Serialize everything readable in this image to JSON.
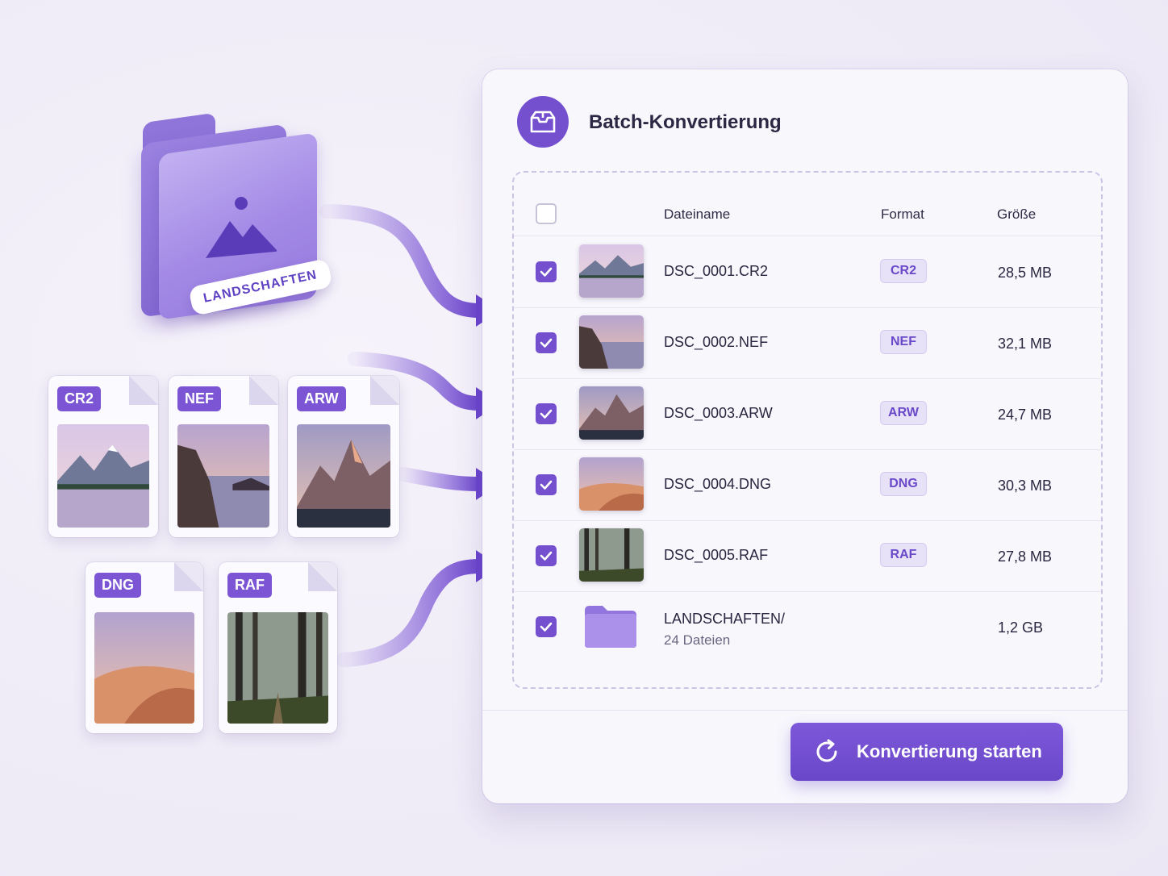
{
  "colors": {
    "accent": "#7450cf",
    "badge_bg": "#e8e2f8",
    "panel_bg": "#f8f7fc"
  },
  "folder_illustration": {
    "icon": "image-folder-icon",
    "label": "LANDSCHAFTEN"
  },
  "source_files": [
    {
      "format": "CR2",
      "photo": "lake-mountains"
    },
    {
      "format": "NEF",
      "photo": "rocky-coast"
    },
    {
      "format": "ARW",
      "photo": "peaks"
    },
    {
      "format": "DNG",
      "photo": "desert-dunes"
    },
    {
      "format": "RAF",
      "photo": "forest-path"
    }
  ],
  "panel": {
    "icon": "inbox-box-icon",
    "title": "Batch-Konvertierung",
    "columns": {
      "name": "Dateiname",
      "format": "Format",
      "size": "Größe"
    },
    "select_all_checked": false,
    "rows": [
      {
        "checked": true,
        "name": "DSC_0001.CR2",
        "format": "CR2",
        "size": "28,5 MB",
        "thumb": "lake-mountains"
      },
      {
        "checked": true,
        "name": "DSC_0002.NEF",
        "format": "NEF",
        "size": "32,1 MB",
        "thumb": "rocky-coast"
      },
      {
        "checked": true,
        "name": "DSC_0003.ARW",
        "format": "ARW",
        "size": "24,7 MB",
        "thumb": "peaks"
      },
      {
        "checked": true,
        "name": "DSC_0004.DNG",
        "format": "DNG",
        "size": "30,3 MB",
        "thumb": "desert-dunes"
      },
      {
        "checked": true,
        "name": "DSC_0005.RAF",
        "format": "RAF",
        "size": "27,8 MB",
        "thumb": "forest-path"
      }
    ],
    "folder_row": {
      "checked": true,
      "name": "LANDSCHAFTEN/",
      "sub": "24 Dateien",
      "size": "1,2 GB",
      "icon": "folder-icon"
    },
    "start_button": {
      "label": "Konvertierung starten",
      "icon": "refresh-icon"
    }
  }
}
